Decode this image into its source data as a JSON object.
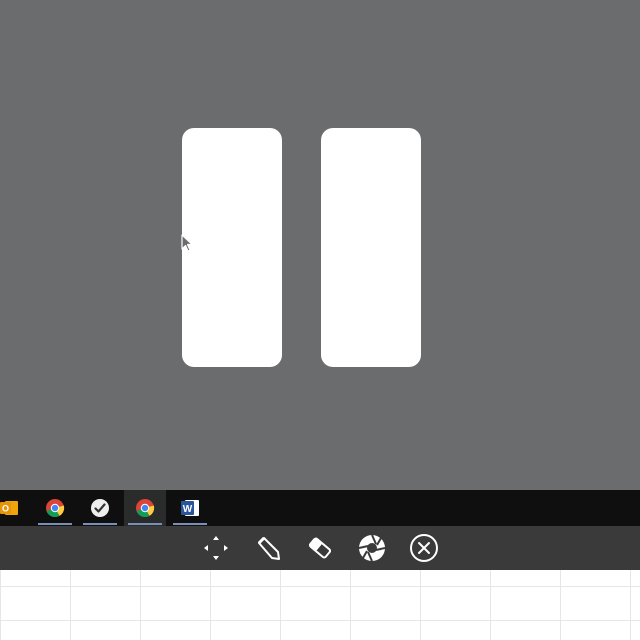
{
  "desktop": {
    "background_color": "#6b6c6d",
    "overlay": "pause-symbol"
  },
  "taskbar": {
    "apps": [
      {
        "name": "outlook",
        "icon": "outlook-icon",
        "running": false,
        "active": false
      },
      {
        "name": "chrome",
        "icon": "chrome-icon",
        "running": true,
        "active": false
      },
      {
        "name": "app",
        "icon": "checkmark-app-icon",
        "running": true,
        "active": false
      },
      {
        "name": "chrome",
        "icon": "chrome-icon",
        "running": true,
        "active": true
      },
      {
        "name": "word",
        "icon": "word-icon",
        "icon_letter": "W",
        "running": true,
        "active": false
      }
    ]
  },
  "annotation_toolbar": {
    "tools": [
      {
        "name": "move",
        "icon": "move-arrows-icon"
      },
      {
        "name": "pen",
        "icon": "pen-icon"
      },
      {
        "name": "eraser",
        "icon": "eraser-icon"
      },
      {
        "name": "capture",
        "icon": "aperture-icon"
      },
      {
        "name": "close",
        "icon": "close-circle-icon"
      }
    ]
  },
  "colors": {
    "taskbar": "#0e0f0e",
    "toolbar": "#3a3a3a",
    "word_blue": "#2b579a",
    "outlook_orange": "#f0a30a"
  }
}
